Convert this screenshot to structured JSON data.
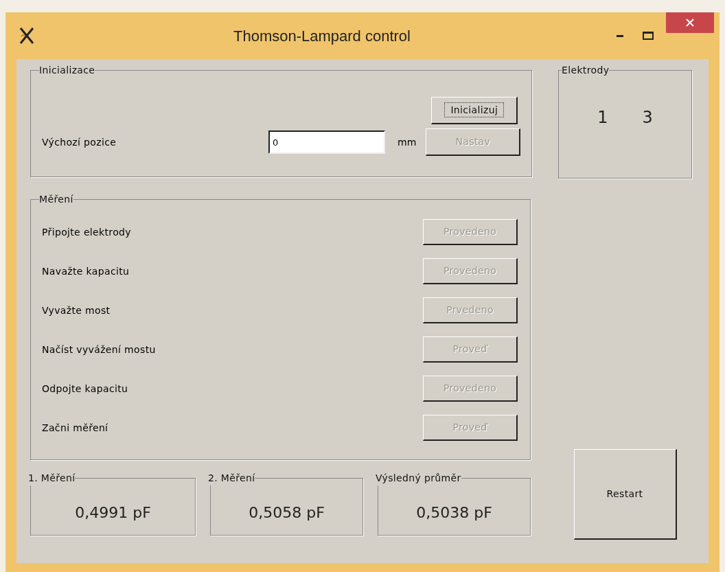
{
  "window": {
    "title": "Thomson-Lampard control"
  },
  "initialization": {
    "title": "Inicializace",
    "init_button": {
      "label": "Inicializuj",
      "disabled": false,
      "focused": true
    },
    "position_label": "Výchozí pozice",
    "position_value": "0",
    "unit": "mm",
    "set_button": {
      "label": "Nastav",
      "disabled": true
    }
  },
  "electrodes": {
    "title": "Elektrody",
    "values": [
      "1",
      "3"
    ]
  },
  "measurement": {
    "title": "Měření",
    "steps": [
      {
        "label": "Připojte elektrody",
        "button": "Provedeno",
        "disabled": true
      },
      {
        "label": "Navažte kapacitu",
        "button": "Provedeno",
        "disabled": true
      },
      {
        "label": "Vyvažte most",
        "button": "Prvedeno",
        "disabled": true
      },
      {
        "label": "Načíst vyvážení mostu",
        "button": "Proveď",
        "disabled": true
      },
      {
        "label": "Odpojte kapacitu",
        "button": "Provedeno",
        "disabled": true
      },
      {
        "label": "Začni měření",
        "button": "Proveď",
        "disabled": true
      }
    ]
  },
  "results": [
    {
      "title": "1. Měření",
      "value": "0,4991 pF"
    },
    {
      "title": "2. Měření",
      "value": "0,5058 pF"
    },
    {
      "title": "Výsledný průměr",
      "value": "0,5038 pF"
    }
  ],
  "restart_button": {
    "label": "Restart",
    "disabled": false
  }
}
